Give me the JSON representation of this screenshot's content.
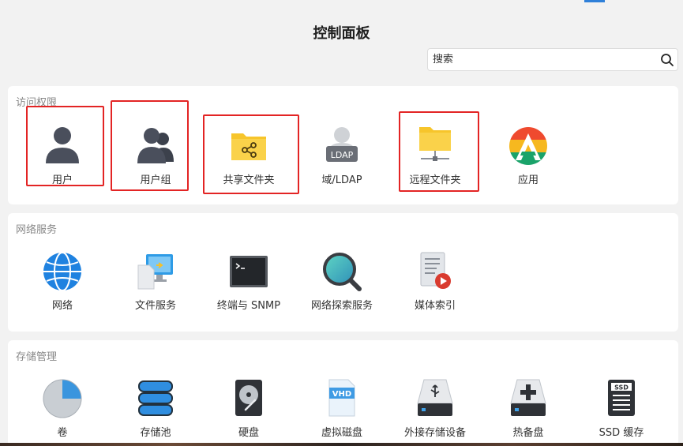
{
  "page": {
    "title": "控制面板"
  },
  "search": {
    "placeholder": "搜索"
  },
  "sections": [
    {
      "title": "访问权限",
      "items": [
        {
          "label": "用户",
          "icon": "user-icon",
          "highlighted": true
        },
        {
          "label": "用户组",
          "icon": "user-group-icon",
          "highlighted": true
        },
        {
          "label": "共享文件夹",
          "icon": "shared-folder-icon",
          "highlighted": true
        },
        {
          "label": "域/LDAP",
          "icon": "ldap-icon",
          "icon_text": "LDAP",
          "highlighted": false
        },
        {
          "label": "远程文件夹",
          "icon": "remote-folder-icon",
          "highlighted": true
        },
        {
          "label": "应用",
          "icon": "application-icon",
          "highlighted": false
        }
      ]
    },
    {
      "title": "网络服务",
      "items": [
        {
          "label": "网络",
          "icon": "network-globe-icon"
        },
        {
          "label": "文件服务",
          "icon": "file-service-icon"
        },
        {
          "label": "终端与 SNMP",
          "icon": "terminal-icon"
        },
        {
          "label": "网络探索服务",
          "icon": "discovery-magnifier-icon"
        },
        {
          "label": "媒体索引",
          "icon": "media-index-icon"
        }
      ]
    },
    {
      "title": "存储管理",
      "items": [
        {
          "label": "卷",
          "icon": "volume-pie-icon"
        },
        {
          "label": "存储池",
          "icon": "storage-pool-icon"
        },
        {
          "label": "硬盘",
          "icon": "hard-disk-icon"
        },
        {
          "label": "虚拟磁盘",
          "icon": "virtual-disk-icon",
          "icon_text": "VHD"
        },
        {
          "label": "外接存储设备",
          "icon": "usb-external-storage-icon"
        },
        {
          "label": "热备盘",
          "icon": "hot-spare-icon"
        },
        {
          "label": "SSD 缓存",
          "icon": "ssd-cache-icon",
          "icon_text": "SSD"
        }
      ]
    }
  ],
  "colors": {
    "highlight": "#e32424",
    "accent": "#2f80d9",
    "folder": "#f7c52b"
  }
}
